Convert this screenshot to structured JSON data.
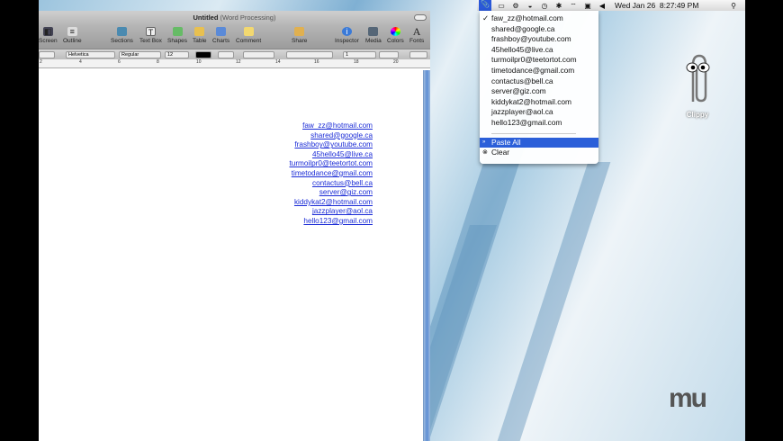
{
  "window": {
    "title": "Untitled",
    "subtitle": "(Word Processing)"
  },
  "toolbar": [
    "Screen",
    "Outline",
    "Sections",
    "Text Box",
    "Shapes",
    "Table",
    "Charts",
    "Comment",
    "Share",
    "Inspector",
    "Media",
    "Colors",
    "Fonts"
  ],
  "format_bar": {
    "font": "Helvetica",
    "style": "Regular",
    "size": "12",
    "spacing": "1"
  },
  "ruler": [
    "2",
    "4",
    "6",
    "8",
    "10",
    "12",
    "14",
    "16",
    "18",
    "20"
  ],
  "document": {
    "emails": [
      "faw_zz@hotmail.com",
      "shared@google.ca",
      "frashboy@youtube.com",
      "45hello45@live.ca",
      "turmoilpr0@teetortot.com",
      "timetodance@gmail.com",
      "contactus@bell.ca",
      "server@giz.com",
      "kiddykat2@hotmail.com",
      "jazzplayer@aol.ca",
      "hello123@gmail.com"
    ]
  },
  "menubar": {
    "clock": "Wed Jan 26  8:27:49 PM"
  },
  "clip_menu": {
    "items": [
      "faw_zz@hotmail.com",
      "shared@google.ca",
      "frashboy@youtube.com",
      "45hello45@live.ca",
      "turmoilpr0@teetortot.com",
      "timetodance@gmail.com",
      "contactus@bell.ca",
      "server@giz.com",
      "kiddykat2@hotmail.com",
      "jazzplayer@aol.ca",
      "hello123@gmail.com"
    ],
    "checked": "✓",
    "paste_all": "Paste All",
    "clear": "Clear"
  },
  "desktop": {
    "clippy_label": "Clippy",
    "logo": "mu"
  },
  "colors": {
    "highlight": "#2b5fd9",
    "link": "#1a2bd6"
  }
}
